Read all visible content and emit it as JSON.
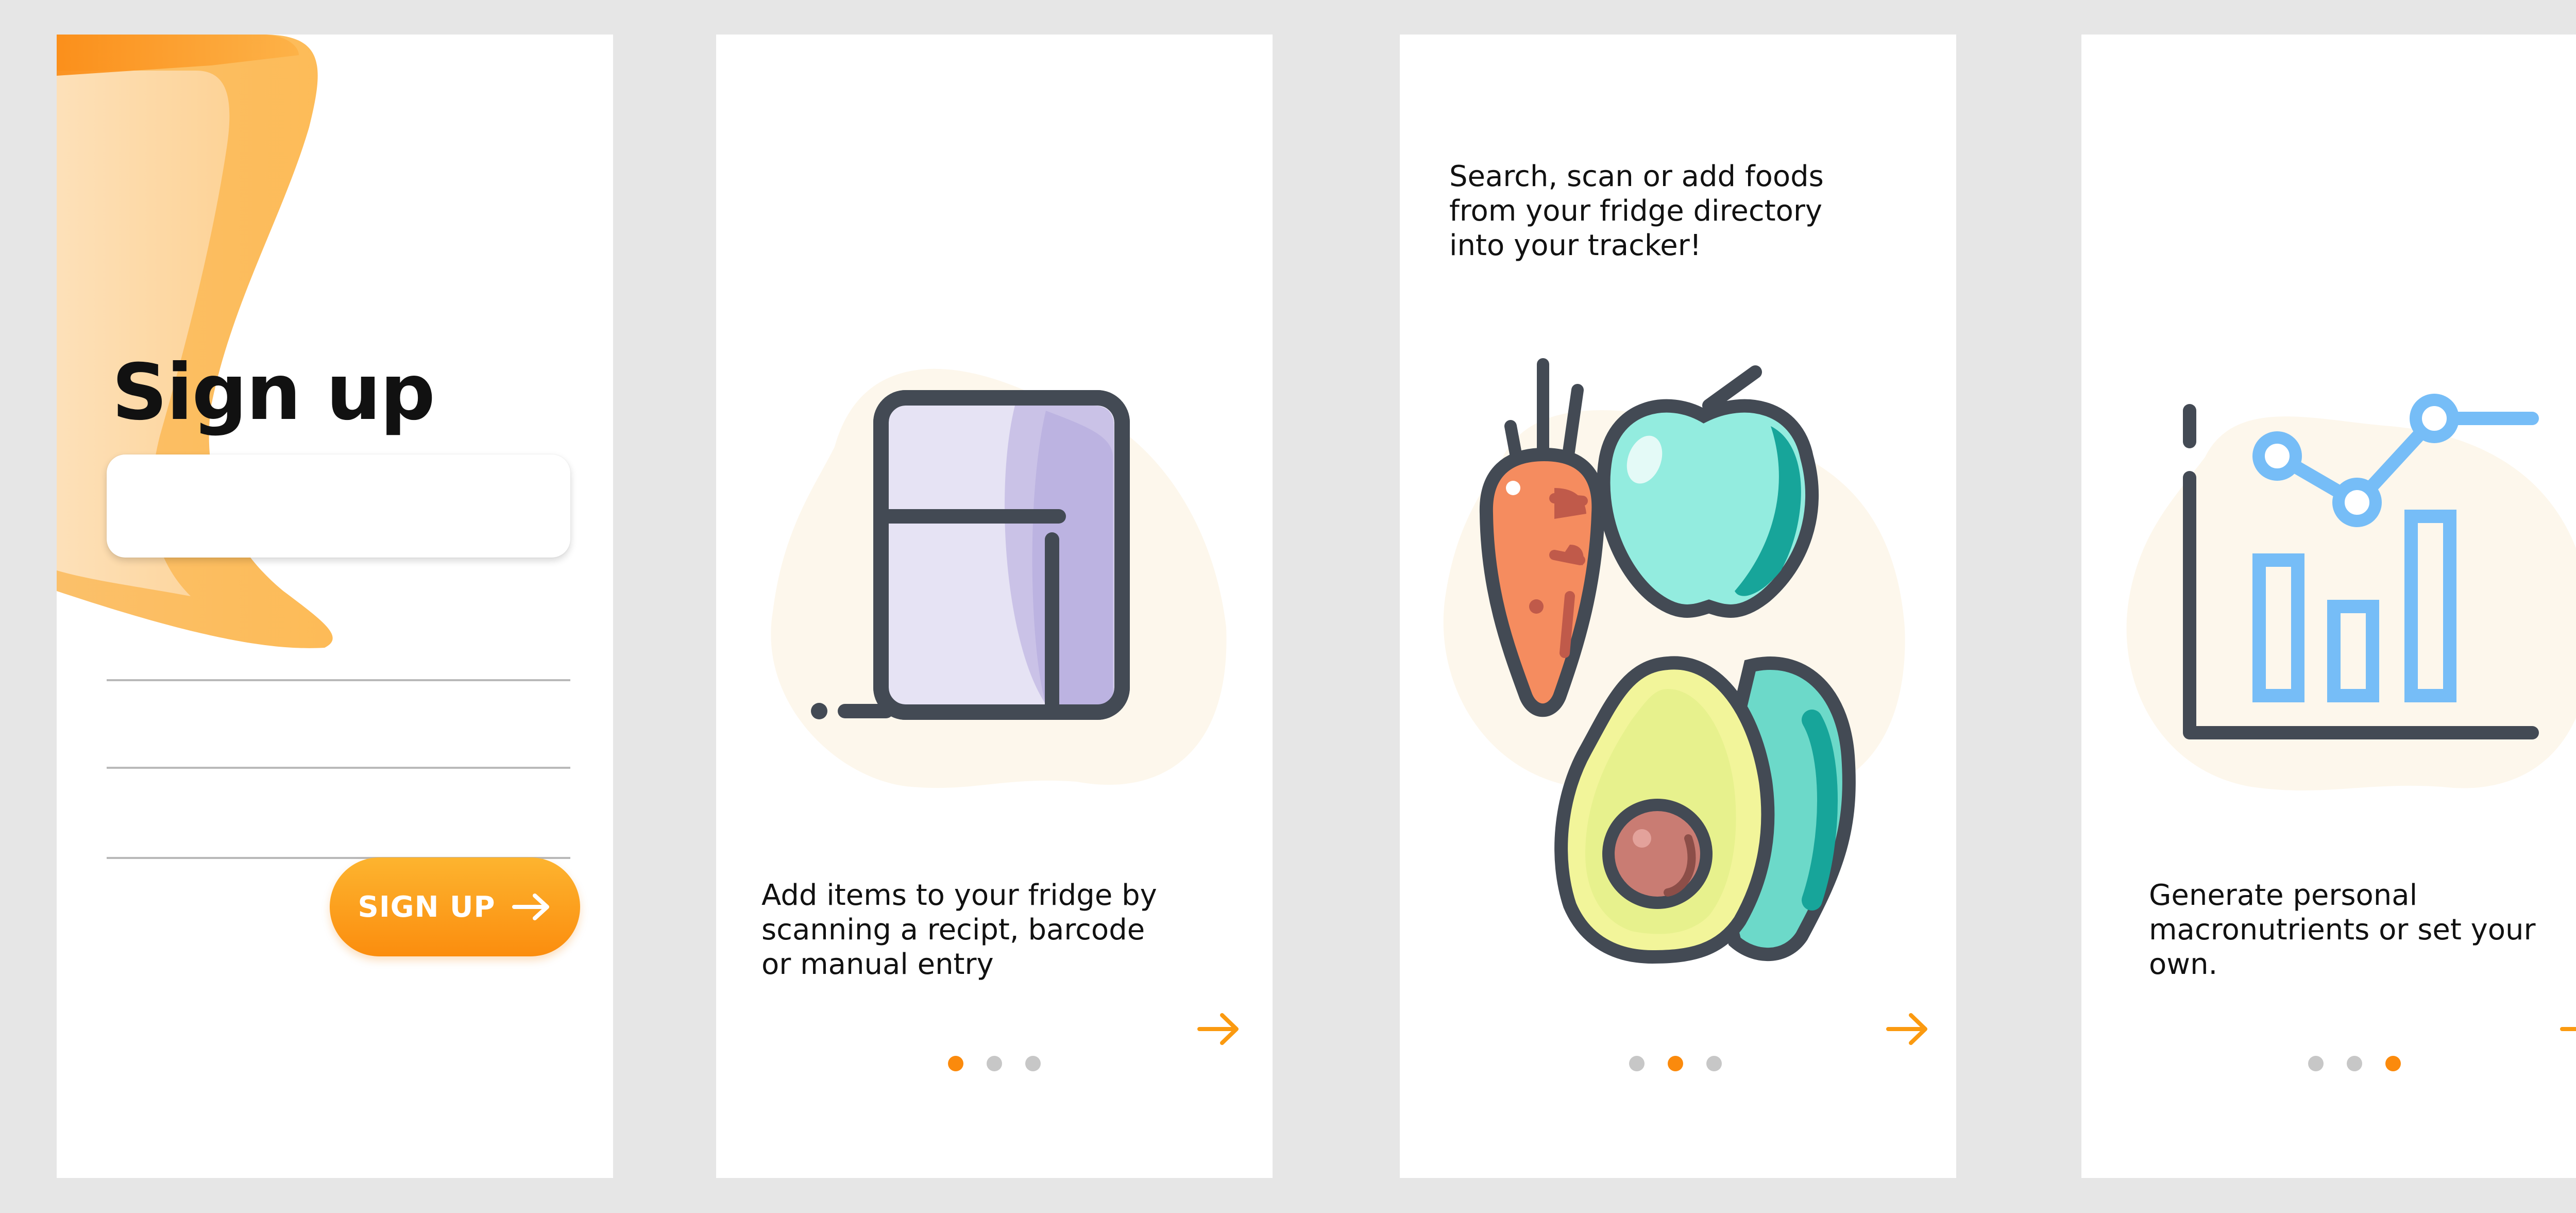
{
  "screens": {
    "signup": {
      "title": "Sign up",
      "button_label": "SIGN UP",
      "button_icon": "arrow-right-icon"
    },
    "onboarding_fridge": {
      "caption": "Add items to your fridge by\nscanning a recipt, barcode\nor manual entry",
      "illustration": "fridge-icon",
      "active_dot": 1
    },
    "onboarding_foods": {
      "caption": "Search, scan or add foods\nfrom your fridge directory\ninto your tracker!",
      "illustration": "fruit-vegetables-icon",
      "active_dot": 2
    },
    "onboarding_macros": {
      "caption": "Generate personal\nmacronutrients or set your\nown.",
      "illustration": "chart-icon",
      "active_dot": 3
    }
  },
  "colors": {
    "accent": "#fb8a0c",
    "accent_light": "#fdb42f",
    "dot_inactive": "#c7c7c7",
    "screen_background": "#ffffff",
    "canvas_background": "#e6e6e6",
    "chart_blue": "#76bdf7",
    "outline_dark": "#434a54"
  }
}
